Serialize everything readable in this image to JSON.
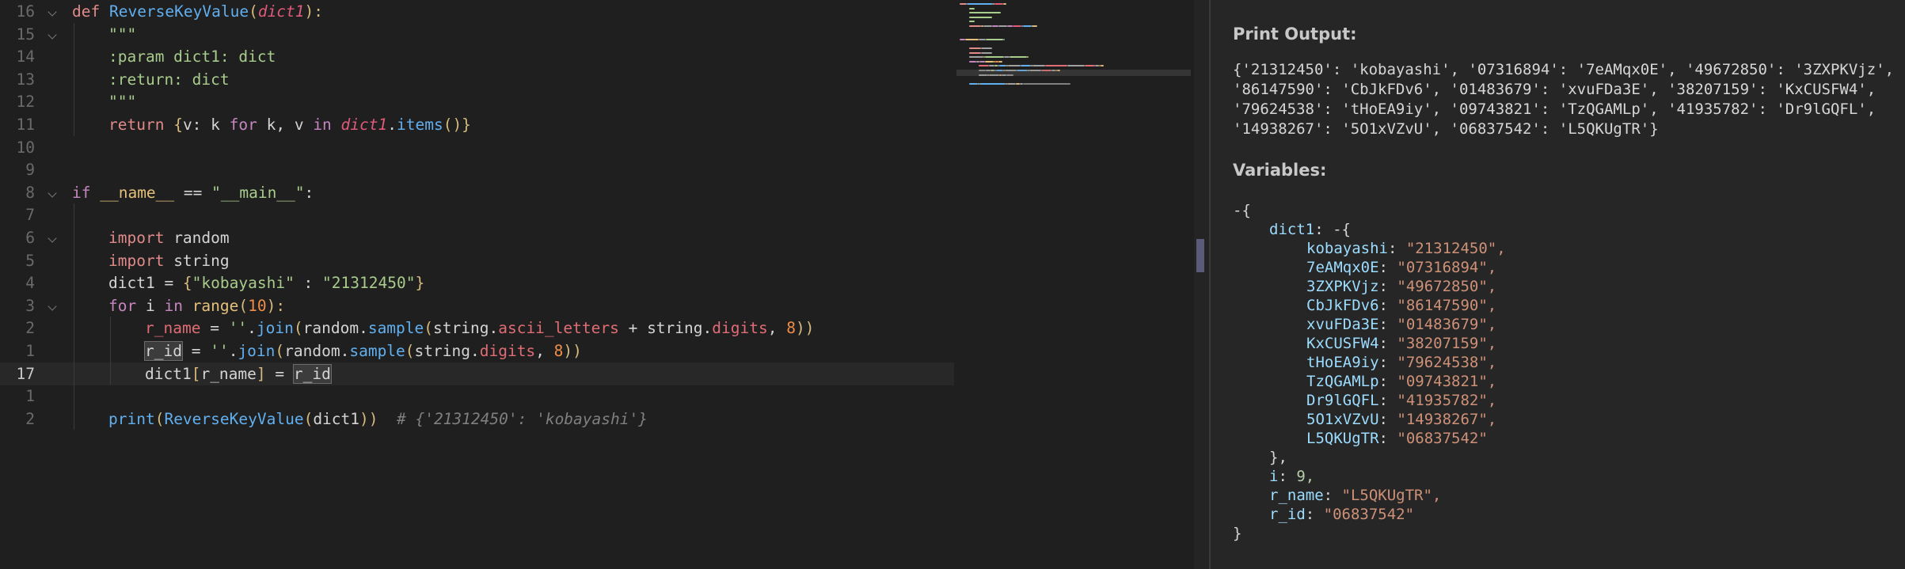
{
  "editor": {
    "lines": [
      {
        "num": "16",
        "fold": true,
        "indent": 0,
        "tokens": [
          [
            "kw",
            "def "
          ],
          [
            "fn",
            "ReverseKeyValue"
          ],
          [
            "pa",
            "("
          ],
          [
            "pm",
            "dict1"
          ],
          [
            "pa",
            "):"
          ]
        ]
      },
      {
        "num": "15",
        "fold": true,
        "indent": 1,
        "tokens": [
          [
            "dc",
            "\"\"\""
          ]
        ]
      },
      {
        "num": "14",
        "fold": false,
        "indent": 1,
        "tokens": [
          [
            "dc",
            ":param dict1: dict"
          ]
        ]
      },
      {
        "num": "13",
        "fold": false,
        "indent": 1,
        "tokens": [
          [
            "dc",
            ":return: dict"
          ]
        ]
      },
      {
        "num": "12",
        "fold": false,
        "indent": 1,
        "tokens": [
          [
            "dc",
            "\"\"\""
          ]
        ]
      },
      {
        "num": "11",
        "fold": false,
        "indent": 1,
        "tokens": [
          [
            "kw",
            "return "
          ],
          [
            "pa",
            "{"
          ],
          [
            "wd",
            "v: k "
          ],
          [
            "k",
            "for "
          ],
          [
            "wd",
            "k, v "
          ],
          [
            "k",
            "in "
          ],
          [
            "pm",
            "dict1"
          ],
          [
            "wd",
            "."
          ],
          [
            "fn",
            "items"
          ],
          [
            "pa",
            "()}"
          ]
        ]
      },
      {
        "num": "10",
        "fold": false,
        "indent": 0,
        "tokens": []
      },
      {
        "num": "9",
        "fold": false,
        "indent": 0,
        "tokens": []
      },
      {
        "num": "8",
        "fold": true,
        "indent": 0,
        "tokens": [
          [
            "k",
            "if "
          ],
          [
            "bi",
            "__name__"
          ],
          [
            "wd",
            " == "
          ],
          [
            "st",
            "\"__main__\""
          ],
          [
            "wd",
            ":"
          ]
        ]
      },
      {
        "num": "7",
        "fold": false,
        "indent": 1,
        "tokens": []
      },
      {
        "num": "6",
        "fold": true,
        "indent": 1,
        "tokens": [
          [
            "kw",
            "import "
          ],
          [
            "wd",
            "random"
          ]
        ]
      },
      {
        "num": "5",
        "fold": false,
        "indent": 1,
        "tokens": [
          [
            "kw",
            "import "
          ],
          [
            "wd",
            "string"
          ]
        ]
      },
      {
        "num": "4",
        "fold": false,
        "indent": 1,
        "tokens": [
          [
            "wd",
            "dict1 = "
          ],
          [
            "pa",
            "{"
          ],
          [
            "st",
            "\"kobayashi\""
          ],
          [
            "wd",
            " : "
          ],
          [
            "st",
            "\"21312450\""
          ],
          [
            "pa",
            "}"
          ]
        ]
      },
      {
        "num": "3",
        "fold": true,
        "indent": 1,
        "tokens": [
          [
            "k",
            "for "
          ],
          [
            "wd",
            "i "
          ],
          [
            "k",
            "in "
          ],
          [
            "bi",
            "range"
          ],
          [
            "pa",
            "("
          ],
          [
            "nm",
            "10"
          ],
          [
            "pa",
            "):"
          ]
        ]
      },
      {
        "num": "2",
        "fold": false,
        "indent": 2,
        "tokens": [
          [
            "at",
            "r_name"
          ],
          [
            "wd",
            " = "
          ],
          [
            "st",
            "''"
          ],
          [
            "wd",
            "."
          ],
          [
            "fn",
            "join"
          ],
          [
            "pa",
            "("
          ],
          [
            "wd",
            "random."
          ],
          [
            "fn",
            "sample"
          ],
          [
            "pa",
            "("
          ],
          [
            "wd",
            "string."
          ],
          [
            "at",
            "ascii_letters"
          ],
          [
            "wd",
            " + string."
          ],
          [
            "at",
            "digits"
          ],
          [
            "wd",
            ", "
          ],
          [
            "nm",
            "8"
          ],
          [
            "pa",
            "))"
          ]
        ]
      },
      {
        "num": "1",
        "fold": false,
        "indent": 2,
        "tokens": [
          [
            "hl",
            "r_id"
          ],
          [
            "wd",
            " = "
          ],
          [
            "st",
            "''"
          ],
          [
            "wd",
            "."
          ],
          [
            "fn",
            "join"
          ],
          [
            "pa",
            "("
          ],
          [
            "wd",
            "random."
          ],
          [
            "fn",
            "sample"
          ],
          [
            "pa",
            "("
          ],
          [
            "wd",
            "string."
          ],
          [
            "at",
            "digits"
          ],
          [
            "wd",
            ", "
          ],
          [
            "nm",
            "8"
          ],
          [
            "pa",
            "))"
          ]
        ]
      },
      {
        "num": "17",
        "fold": false,
        "indent": 2,
        "current": true,
        "tokens": [
          [
            "wd",
            "dict1"
          ],
          [
            "pa",
            "["
          ],
          [
            "wd",
            "r_name"
          ],
          [
            "pa",
            "]"
          ],
          [
            "wd",
            " = "
          ],
          [
            "hl",
            "r_id"
          ]
        ]
      },
      {
        "num": "1",
        "fold": false,
        "indent": 1,
        "tokens": []
      },
      {
        "num": "2",
        "fold": false,
        "indent": 1,
        "tokens": [
          [
            "fn",
            "print"
          ],
          [
            "pa",
            "("
          ],
          [
            "fn",
            "ReverseKeyValue"
          ],
          [
            "pa",
            "("
          ],
          [
            "wd",
            "dict1"
          ],
          [
            "pa",
            "))"
          ],
          [
            "wd",
            "  "
          ],
          [
            "cm",
            "# {'21312450': 'kobayashi'}"
          ]
        ]
      }
    ]
  },
  "panel": {
    "print_heading": "Print Output:",
    "print_lines": [
      "{'21312450': 'kobayashi', '07316894': '7eAMqx0E', '49672850': '3ZXPKVjz',",
      "'86147590': 'CbJkFDv6', '01483679': 'xvuFDa3E', '38207159': 'KxCUSFW4',",
      "'79624538': 'tHoEA9iy', '09743821': 'TzQGAMLp', '41935782': 'Dr9lGQFL',",
      "'14938267': '5O1xVZvU', '06837542': 'L5QKUgTR'}"
    ],
    "vars_heading": "Variables:",
    "open_brace": "-{",
    "dict1_label": "dict1: -{",
    "dict1_entries": [
      {
        "k": "kobayashi",
        "v": "\"21312450\","
      },
      {
        "k": "7eAMqx0E",
        "v": "\"07316894\","
      },
      {
        "k": "3ZXPKVjz",
        "v": "\"49672850\","
      },
      {
        "k": "CbJkFDv6",
        "v": "\"86147590\","
      },
      {
        "k": "xvuFDa3E",
        "v": "\"01483679\","
      },
      {
        "k": "KxCUSFW4",
        "v": "\"38207159\","
      },
      {
        "k": "tHoEA9iy",
        "v": "\"79624538\","
      },
      {
        "k": "TzQGAMLp",
        "v": "\"09743821\","
      },
      {
        "k": "Dr9lGQFL",
        "v": "\"41935782\","
      },
      {
        "k": "5O1xVZvU",
        "v": "\"14938267\","
      },
      {
        "k": "L5QKUgTR",
        "v": "\"06837542\""
      }
    ],
    "close_inner": "},",
    "others": [
      {
        "k": "i",
        "v": "9,",
        "type": "num"
      },
      {
        "k": "r_name",
        "v": "\"L5QKUgTR\",",
        "type": "str"
      },
      {
        "k": "r_id",
        "v": "\"06837542\"",
        "type": "str"
      }
    ],
    "close_outer": "}"
  }
}
